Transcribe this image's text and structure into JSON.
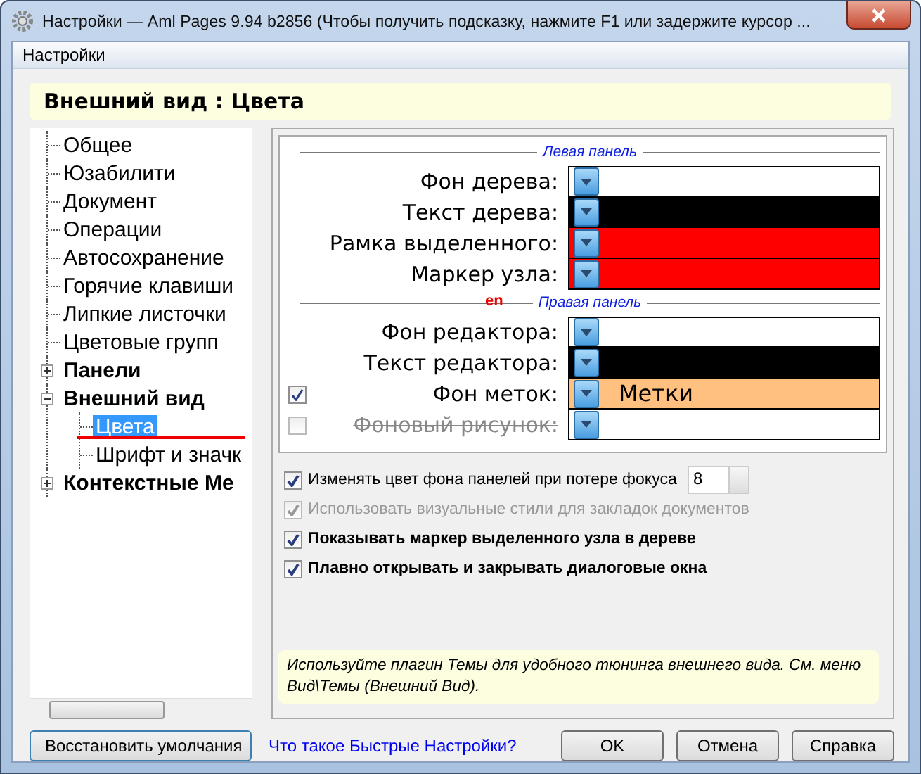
{
  "window": {
    "title": "Настройки — Aml Pages 9.94 b2856 (Чтобы получить подсказку, нажмите F1 или задержите курсор ..."
  },
  "menu": [
    "Настройки"
  ],
  "header": "Внешний вид : Цвета",
  "tree": [
    {
      "label": "Общее",
      "kind": "leaf",
      "selected": false
    },
    {
      "label": "Юзабилити",
      "kind": "leaf",
      "selected": false
    },
    {
      "label": "Документ",
      "kind": "leaf",
      "selected": false
    },
    {
      "label": "Операции",
      "kind": "leaf",
      "selected": false
    },
    {
      "label": "Автосохранение",
      "kind": "leaf",
      "selected": false
    },
    {
      "label": "Горячие клавиши",
      "kind": "leaf",
      "selected": false
    },
    {
      "label": "Липкие листочки",
      "kind": "leaf",
      "selected": false
    },
    {
      "label": "Цветовые групп",
      "kind": "leaf",
      "selected": false
    },
    {
      "label": "Панели",
      "kind": "group",
      "expanded": false,
      "selected": false
    },
    {
      "label": "Внешний вид",
      "kind": "group",
      "expanded": true,
      "selected": false,
      "children": [
        {
          "label": "Цвета",
          "selected": true
        },
        {
          "label": "Шрифт и значк",
          "selected": false
        }
      ]
    },
    {
      "label": "Контекстные Ме",
      "kind": "group",
      "expanded": false,
      "selected": false
    }
  ],
  "color_sections": [
    {
      "title": "Левая панель",
      "rows": [
        {
          "label": "Фон дерева:",
          "kind": "plain",
          "color": "#ffffff"
        },
        {
          "label": "Текст дерева:",
          "kind": "plain",
          "color": "#000000"
        },
        {
          "label": "Рамка выделенного:",
          "kind": "plain",
          "color": "#ff0000"
        },
        {
          "label": "Маркер узла:",
          "kind": "plain",
          "color": "#ff0000"
        }
      ]
    },
    {
      "title": "Правая панель",
      "rows": [
        {
          "label": "Фон редактора:",
          "kind": "plain",
          "color": "#ffffff"
        },
        {
          "label": "Текст редактора:",
          "kind": "plain",
          "color": "#000000"
        },
        {
          "label": "Фон меток:",
          "kind": "checkbox",
          "checked": true,
          "disabled": false,
          "color": "#ffc080",
          "sample": "Метки"
        },
        {
          "label": "Фоновый рисунок:",
          "kind": "checkbox",
          "checked": false,
          "disabled": true,
          "color": "#ffffff"
        }
      ]
    }
  ],
  "language_indicator": "en",
  "options": [
    {
      "label": "Изменять цвет фона панелей при потере фокуса",
      "checked": true,
      "disabled": false,
      "bold": false,
      "spinner": "8"
    },
    {
      "label": "Использовать визуальные стили для закладок документов",
      "checked": true,
      "disabled": true,
      "bold": false
    },
    {
      "label": "Показывать маркер выделенного узла в дереве",
      "checked": true,
      "disabled": false,
      "bold": true
    },
    {
      "label": "Плавно открывать и закрывать диалоговые окна",
      "checked": true,
      "disabled": false,
      "bold": true
    }
  ],
  "hint": "Используйте плагин Темы для удобного тюнинга внешнего вида. См. меню Вид\\Темы (Внешний Вид).",
  "footer": {
    "reset_button": "Восстановить умолчания",
    "link": "Что такое Быстрые Настройки?",
    "buttons": [
      "OK",
      "Отмена",
      "Справка"
    ]
  }
}
